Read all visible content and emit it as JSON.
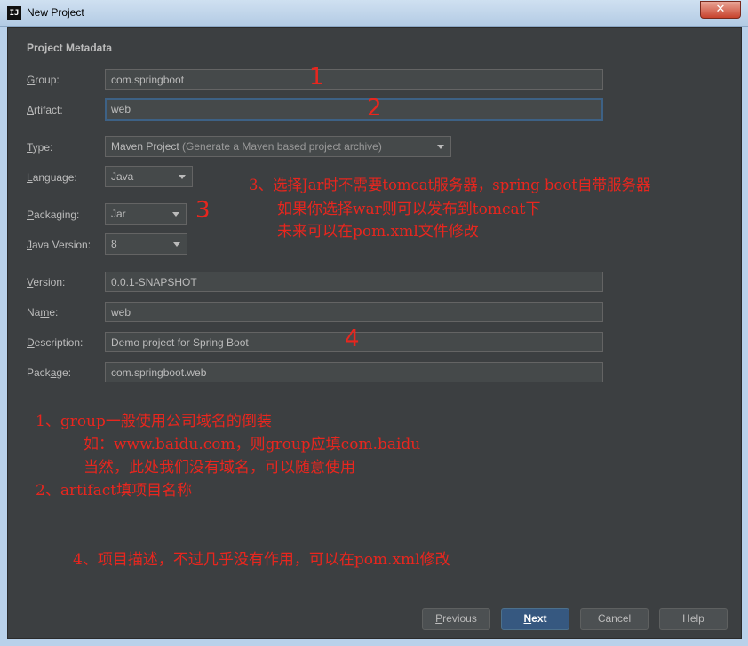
{
  "window": {
    "title": "New Project",
    "app_icon": "IJ",
    "close_glyph": "✕"
  },
  "section_title": "Project Metadata",
  "fields": {
    "group": {
      "label_mn": "G",
      "label_rest": "roup:",
      "value": "com.springboot"
    },
    "artifact": {
      "label_mn": "A",
      "label_rest": "rtifact:",
      "value": "web"
    },
    "type": {
      "label_mn": "T",
      "label_rest": "ype:",
      "value": "Maven Project",
      "hint": "(Generate a Maven based project archive)"
    },
    "language": {
      "label_mn": "L",
      "label_rest": "anguage:",
      "value": "Java"
    },
    "packaging": {
      "label_mn": "P",
      "label_rest": "ackaging:",
      "value": "Jar"
    },
    "java_version": {
      "label_mn": "J",
      "label_rest": "ava Version:",
      "value": "8"
    },
    "version": {
      "label_mn": "V",
      "label_rest": "ersion:",
      "value": "0.0.1-SNAPSHOT"
    },
    "name": {
      "label_pre": "Na",
      "label_mn": "m",
      "label_rest": "e:",
      "value": "web"
    },
    "description": {
      "label_mn": "D",
      "label_rest": "escription:",
      "value": "Demo project for Spring Boot"
    },
    "package": {
      "label_pre": "Pack",
      "label_mn": "a",
      "label_rest": "ge:",
      "value": "com.springboot.web"
    }
  },
  "annotations": {
    "markers": [
      "1",
      "2",
      "3",
      "4"
    ],
    "note3_line1": "3、选择Jar时不需要tomcat服务器，spring boot自带服务器",
    "note3_line2": "如果你选择war则可以发布到tomcat下",
    "note3_line3": "未来可以在pom.xml文件修改",
    "note1_line1": "1、group一般使用公司域名的倒装",
    "note1_line2": "如：www.baidu.com，则group应填com.baidu",
    "note1_line3": "当然，此处我们没有域名，可以随意使用",
    "note2_line1": "2、artifact填项目名称",
    "note4_line1": "4、项目描述，不过几乎没有作用，可以在pom.xml修改"
  },
  "buttons": {
    "previous": {
      "mn": "P",
      "rest": "revious"
    },
    "next": {
      "mn": "N",
      "rest": "ext"
    },
    "cancel": {
      "label": "Cancel"
    },
    "help": {
      "label": "Help"
    }
  },
  "colors": {
    "background": "#3c3f41",
    "field": "#45494a",
    "text": "#bbbbbb",
    "annotation": "#e8261e",
    "primary_button": "#365880"
  }
}
